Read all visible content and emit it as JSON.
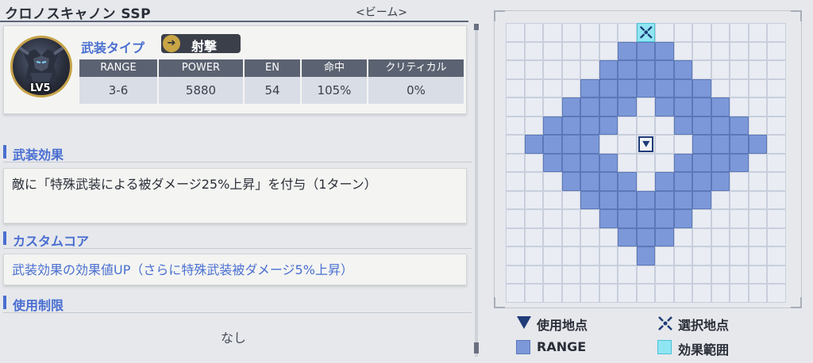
{
  "weapon": {
    "name": "クロノスキャノン SSP",
    "attribute": "<ビーム>"
  },
  "info": {
    "level": "LV5",
    "type_label": "武装タイプ",
    "type_value": "射撃",
    "stats": [
      {
        "head": "RANGE",
        "value": "3-6"
      },
      {
        "head": "POWER",
        "value": "5880"
      },
      {
        "head": "EN",
        "value": "54"
      },
      {
        "head": "命中",
        "value": "105%"
      },
      {
        "head": "クリティカル",
        "value": "0%"
      }
    ]
  },
  "sections": {
    "effect": {
      "title": "武装効果",
      "text": "敵に「特殊武装による被ダメージ25%上昇」を付与（1ターン）"
    },
    "custom": {
      "title": "カスタムコア",
      "text": "武装効果の効果値UP（さらに特殊武装被ダメージ5%上昇）"
    },
    "limit": {
      "title": "使用制限",
      "text": "なし"
    }
  },
  "range_grid": {
    "size": 15,
    "use_point": [
      6,
      7
    ],
    "select_point": [
      0,
      7
    ],
    "effect_cells": [
      [
        0,
        7
      ]
    ],
    "range_cells": [
      [
        1,
        6
      ],
      [
        1,
        7
      ],
      [
        1,
        8
      ],
      [
        2,
        5
      ],
      [
        2,
        6
      ],
      [
        2,
        7
      ],
      [
        2,
        8
      ],
      [
        2,
        9
      ],
      [
        3,
        4
      ],
      [
        3,
        5
      ],
      [
        3,
        6
      ],
      [
        3,
        7
      ],
      [
        3,
        8
      ],
      [
        3,
        9
      ],
      [
        3,
        10
      ],
      [
        4,
        3
      ],
      [
        4,
        4
      ],
      [
        4,
        5
      ],
      [
        4,
        6
      ],
      [
        4,
        8
      ],
      [
        4,
        9
      ],
      [
        4,
        10
      ],
      [
        4,
        11
      ],
      [
        5,
        2
      ],
      [
        5,
        3
      ],
      [
        5,
        4
      ],
      [
        5,
        5
      ],
      [
        5,
        9
      ],
      [
        5,
        10
      ],
      [
        5,
        11
      ],
      [
        5,
        12
      ],
      [
        6,
        1
      ],
      [
        6,
        2
      ],
      [
        6,
        3
      ],
      [
        6,
        4
      ],
      [
        6,
        10
      ],
      [
        6,
        11
      ],
      [
        6,
        12
      ],
      [
        6,
        13
      ],
      [
        7,
        2
      ],
      [
        7,
        3
      ],
      [
        7,
        4
      ],
      [
        7,
        5
      ],
      [
        7,
        9
      ],
      [
        7,
        10
      ],
      [
        7,
        11
      ],
      [
        7,
        12
      ],
      [
        8,
        3
      ],
      [
        8,
        4
      ],
      [
        8,
        5
      ],
      [
        8,
        6
      ],
      [
        8,
        8
      ],
      [
        8,
        9
      ],
      [
        8,
        10
      ],
      [
        8,
        11
      ],
      [
        9,
        4
      ],
      [
        9,
        5
      ],
      [
        9,
        6
      ],
      [
        9,
        7
      ],
      [
        9,
        8
      ],
      [
        9,
        9
      ],
      [
        9,
        10
      ],
      [
        10,
        5
      ],
      [
        10,
        6
      ],
      [
        10,
        7
      ],
      [
        10,
        8
      ],
      [
        10,
        9
      ],
      [
        11,
        6
      ],
      [
        11,
        7
      ],
      [
        11,
        8
      ],
      [
        12,
        7
      ]
    ]
  },
  "legend": {
    "use_point": "使用地点",
    "select_point": "選択地点",
    "range": "RANGE",
    "effect_area": "効果範囲"
  },
  "colors": {
    "accent": "#4a6fd1",
    "range": "#7c98d8",
    "effect": "#8fe6f2",
    "badge": "#c9a545"
  }
}
